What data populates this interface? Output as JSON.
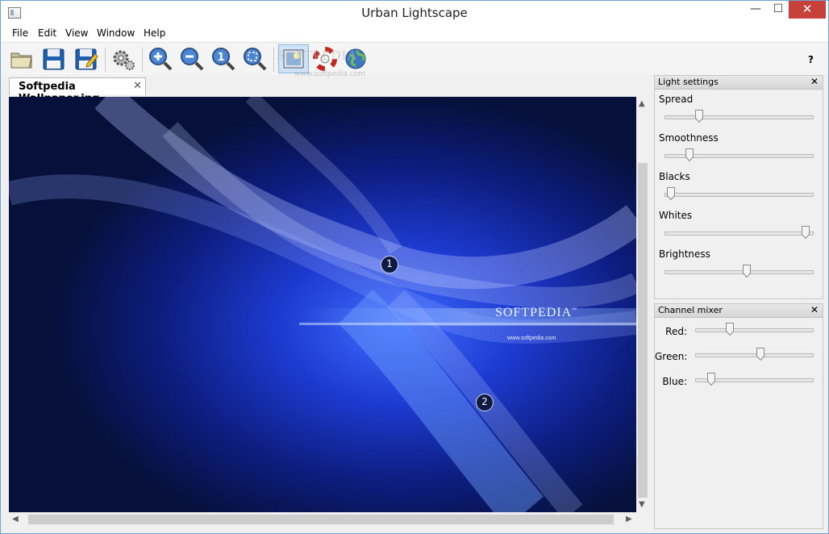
{
  "window": {
    "title": "Urban Lightscape",
    "controls": {
      "minimize": "—",
      "maximize": "☐",
      "close": "✕"
    }
  },
  "menu": [
    "File",
    "Edit",
    "View",
    "Window",
    "Help"
  ],
  "toolbar": {
    "buttons": [
      "open-folder-icon",
      "save-icon",
      "save-as-icon",
      "settings-gear-icon",
      "zoom-in-icon",
      "zoom-out-icon",
      "zoom-actual-size-icon",
      "zoom-fit-icon",
      "image-view-icon",
      "help-lifebuoy-icon",
      "web-globe-icon"
    ],
    "help": "?",
    "watermark": "SOFTPEDIA",
    "watermark_url": "www.softpedia.com"
  },
  "document": {
    "tab_label": "Softpedia Wallpaper.jpg",
    "tab_close": "✕",
    "image": {
      "brand": "SOFTPEDIA",
      "brand_tm": "™",
      "url": "www.softpedia.com",
      "markers": [
        "1",
        "2"
      ]
    },
    "scroll_arrows": {
      "up": "▲",
      "down": "▼",
      "left": "◀",
      "right": "▶"
    }
  },
  "light_settings": {
    "title": "Light settings",
    "close": "✕",
    "sliders": [
      {
        "label": "Spread",
        "value": 0.22
      },
      {
        "label": "Smoothness",
        "value": 0.15
      },
      {
        "label": "Blacks",
        "value": 0.02
      },
      {
        "label": "Whites",
        "value": 0.98
      },
      {
        "label": "Brightness",
        "value": 0.56
      }
    ]
  },
  "channel_mixer": {
    "title": "Channel mixer",
    "close": "✕",
    "sliders": [
      {
        "label": "Red:",
        "value": 0.28
      },
      {
        "label": "Green:",
        "value": 0.56
      },
      {
        "label": "Blue:",
        "value": 0.11
      }
    ]
  },
  "colors": {
    "accent": "#6fa3d6",
    "close_button": "#c8403a",
    "canvas_bg": "#07103e"
  }
}
